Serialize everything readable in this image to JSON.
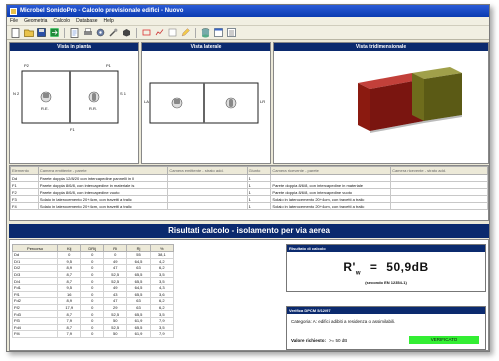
{
  "window": {
    "title": "Microbel SonidoPro - Calcolo previsionale edifici - Nuovo"
  },
  "menu": {
    "items": [
      "File",
      "Geometria",
      "Calcolo",
      "Database",
      "Help"
    ]
  },
  "toolbar": {
    "icons": [
      "new-icon",
      "open-icon",
      "save-icon",
      "export-icon",
      "report-icon",
      "print-icon",
      "settings-icon",
      "tools-icon",
      "box-icon",
      "wall-icon",
      "graph-icon",
      "note-icon",
      "edit-icon",
      "db-icon",
      "window-icon",
      "list-icon"
    ]
  },
  "views": {
    "plan": {
      "title": "Vista in pianta",
      "labels": {
        "p2": "P2",
        "p1": "P1",
        "f1": "F1",
        "f2": "F2",
        "n2": "N 2",
        "n1": "N 1",
        "s1": "S 1",
        "s2": "S 2",
        "room_a": "R.E.",
        "room_b": "R.R."
      }
    },
    "side": {
      "title": "Vista laterale",
      "labels": {
        "l1": "LA",
        "l2": "LR"
      }
    },
    "three_d": {
      "title": "Vista tridimensionale"
    }
  },
  "elements_table": {
    "headers": [
      "Elemento",
      "Camera emittente - parete",
      "Camera emittente - strato add.",
      "Giunto",
      "Camera ricevente - parete",
      "Camera ricevente - strato add."
    ],
    "rows": [
      [
        "Dd",
        "Parete doppia 12/8/20 con intercapedine pannelli in ll",
        "",
        "1",
        "",
        ""
      ],
      [
        "F1",
        "Parete doppia 8/6/8, con intercapedine in materiale is",
        "",
        "1",
        "Parete doppia 8/6/8, con intercapedine in materiale",
        ""
      ],
      [
        "F2",
        "Parete doppia 8/6/8, con intercapedine vuoto",
        "",
        "1",
        "Parete doppia 8/6/8, con intercapedine vuoto",
        ""
      ],
      [
        "F3",
        "Solaio in laterocemento 20+4cm, con travetti a tralic",
        "",
        "1",
        "Solaio in laterocemento 20+4cm, con travetti a tralic",
        ""
      ],
      [
        "F4",
        "Solaio in laterocemento 20+4cm, con travetti a tralic",
        "",
        "1",
        "Solaio in laterocemento 20+4cm, con travetti a tralic",
        ""
      ]
    ]
  },
  "results": {
    "header": "Risultati calcolo - isolamento per via aerea",
    "table": {
      "headers": [
        "Percorso",
        "Kij",
        "DRij",
        "Ri",
        "Rj",
        "%"
      ],
      "rows": [
        [
          "Dd",
          "0",
          "0",
          "0",
          "55",
          "38,1"
        ],
        [
          "D/1",
          "9,5",
          "0",
          "49",
          "64,5",
          "4,2"
        ],
        [
          "D/2",
          "8,9",
          "0",
          "47",
          "63",
          "6,2"
        ],
        [
          "D/3",
          "8,7",
          "0",
          "52,5",
          "65,5",
          "3,5"
        ],
        [
          "D/4",
          "8,7",
          "0",
          "52,5",
          "65,5",
          "3,5"
        ],
        [
          "Fd1",
          "9,5",
          "0",
          "49",
          "64,5",
          "4,3"
        ],
        [
          "Ff1",
          "16",
          "0",
          "43",
          "65,5",
          "3,6"
        ],
        [
          "Fd2",
          "8,9",
          "0",
          "47",
          "63",
          "6,2"
        ],
        [
          "Ff2",
          "17,9",
          "0",
          "29",
          "63",
          "6,2"
        ],
        [
          "Fd3",
          "8,7",
          "0",
          "52,5",
          "65,5",
          "3,5"
        ],
        [
          "Ff3",
          "7,9",
          "0",
          "50",
          "61,9",
          "7,9"
        ],
        [
          "Fd4",
          "8,7",
          "0",
          "52,5",
          "65,5",
          "3,5"
        ],
        [
          "Ff4",
          "7,9",
          "0",
          "50",
          "61,9",
          "7,9"
        ]
      ]
    },
    "calc_panel": {
      "title": "Risultato di calcolo",
      "symbol": "R'",
      "subscript": "w",
      "value": "50,9dB",
      "norm": "(secondo EN 12354-1)"
    },
    "dpcm_panel": {
      "title": "Verifica DPCM 5/12/97",
      "category": "Categoria: A: edifici adibiti a residenza o assimilabili.",
      "required_label": "Valore richiesto:",
      "required_value": ">= 50 dB",
      "status": "VERIFICATO"
    }
  },
  "colors": {
    "accent": "#0b2a6e",
    "ok": "#33ee33",
    "box_red": "#8b1a10",
    "box_green": "#5b5a15"
  }
}
